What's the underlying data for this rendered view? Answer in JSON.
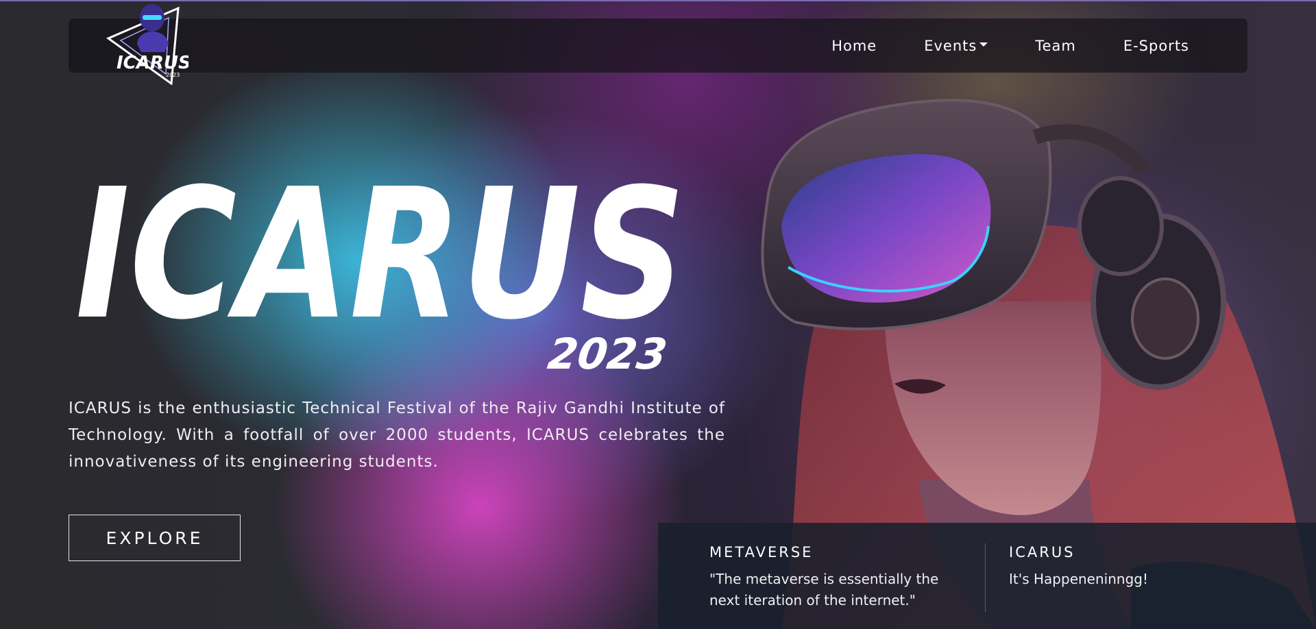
{
  "brand": {
    "logo_text": "ICARUS",
    "logo_year": "2023"
  },
  "nav": {
    "items": [
      {
        "label": "Home"
      },
      {
        "label": "Events"
      },
      {
        "label": "Team"
      },
      {
        "label": "E-Sports"
      }
    ]
  },
  "hero": {
    "title": "ICARUS",
    "year": "2023",
    "description": "ICARUS is the enthusiastic Technical Festival of the Rajiv Gandhi Institute of Technology. With a footfall of over 2000 students, ICARUS celebrates the innovativeness of its engineering students.",
    "cta_label": "EXPLORE"
  },
  "info_panel": {
    "items": [
      {
        "title": "METAVERSE",
        "text": "\"The metaverse is essentially the next iteration of the internet.\""
      },
      {
        "title": "ICARUS",
        "text": "It's Happeneninngg!"
      }
    ]
  },
  "colors": {
    "accent_cyan": "#3cc8eb",
    "accent_magenta": "#dc46c8",
    "accent_violet": "#786ee6",
    "top_line": "#7b6bb3"
  }
}
